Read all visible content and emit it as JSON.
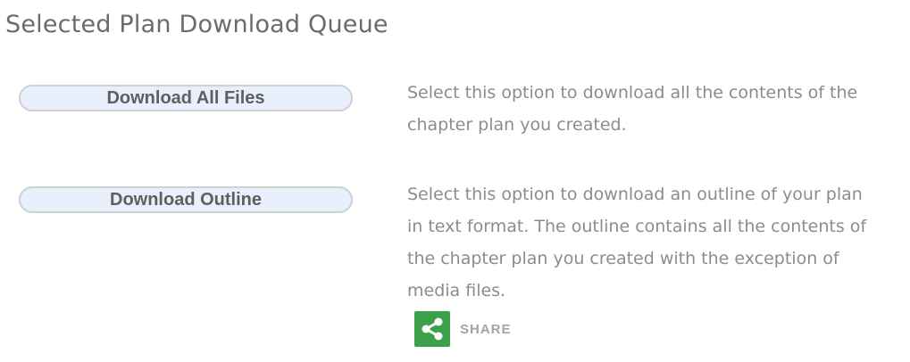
{
  "page": {
    "title": "Selected Plan Download Queue"
  },
  "options": [
    {
      "button_label": "Download All Files",
      "description": "Select this option to download all the contents of the chapter plan you created."
    },
    {
      "button_label": "Download Outline",
      "description": "Select this option to download an outline of your plan in text format. The outline contains all the contents of the chapter plan you created with the exception of media files."
    }
  ],
  "share": {
    "label": "SHARE",
    "icon": "share-icon",
    "color": "#3aa14a"
  },
  "colors": {
    "button_fill": "#e8effd",
    "button_border": "#cfcfcf",
    "title_text": "#6b6b6b",
    "description_text": "#8c8c8c"
  }
}
